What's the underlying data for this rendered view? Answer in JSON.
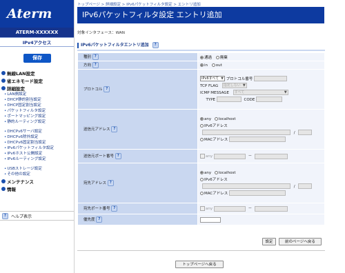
{
  "sidebar": {
    "logo": "Aterm",
    "device_name": "ATERM-XXXXXX",
    "access": "IPv4アクセス",
    "save": "保存",
    "menu": [
      {
        "head": "無線LAN設定",
        "items": []
      },
      {
        "head": "省エネモード設定",
        "items": []
      },
      {
        "head": "詳細設定",
        "items": [
          "LAN側設定",
          "DHCP静的割当設定",
          "DHCP固定割当設定",
          "パケットフィルタ設定",
          "ポートマッピング設定",
          "静的ルーティング設定"
        ]
      },
      {
        "head": "",
        "items": [
          "DHCPv6サーバ設定",
          "DHCPv6除外設定",
          "DHCPv6固定割当設定",
          "IPv6パケットフィルタ設定",
          "IPv6ホスト公開設定",
          "IPv6ルーティング設定"
        ]
      },
      {
        "head": "",
        "items": [
          "USBストレージ設定",
          "その他の設定"
        ]
      },
      {
        "head": "メンテナンス",
        "items": []
      },
      {
        "head": "情報",
        "items": []
      }
    ],
    "help": "ヘルプ表示"
  },
  "main": {
    "breadcrumb": "トップページ > 詳細設定 > IPv6パケットフィルタ設定 > エントリ追加",
    "title": "IPv6パケットフィルタ設定 エントリ追加",
    "interface": "対象インタフェース：WAN",
    "section": "IPv6パケットフィルタエントリ追加",
    "help_icon": "?"
  },
  "form": {
    "kind_label": "種別",
    "kind_options": [
      "通過",
      "廃棄"
    ],
    "direction_label": "方向",
    "direction_options": [
      "in",
      "out"
    ],
    "protocol_label": "プロトコル",
    "protocol_value": "IPv6すべて",
    "protocol_number": "プロトコル番号",
    "tcp_flag": "TCP FLAG",
    "tcp_flag_value": "指定しない",
    "icmp_message": "ICMP MESSAGE",
    "icmp_value": "すべて",
    "type": "TYPE",
    "code": "CODE",
    "src_addr_label": "送信元アドレス",
    "src_port_label": "送信元ポート番号",
    "dst_addr_label": "宛先アドレス",
    "dst_port_label": "宛先ポート番号",
    "priority_label": "優先度",
    "any": "any",
    "localhost": "localhost",
    "ipv6_address": "IPv6アドレス",
    "mac_address": "MACアドレス",
    "slash": "/",
    "dash": "－"
  },
  "buttons": {
    "set": "設定",
    "back": "前のページへ戻る",
    "top": "トップページへ戻る"
  },
  "colors": {
    "brand": "#0d3aa0",
    "label_bg": "#c9d7f0",
    "value_bg": "#f1f4fb"
  }
}
